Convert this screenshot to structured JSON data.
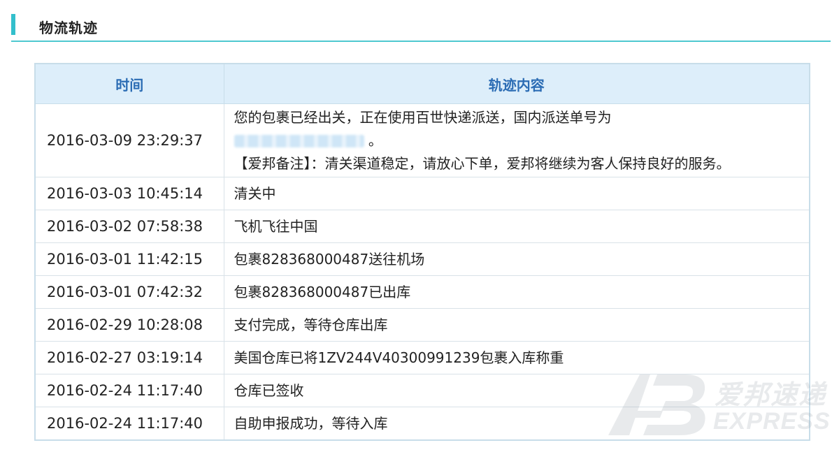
{
  "section": {
    "title": "物流轨迹"
  },
  "table": {
    "headers": {
      "time": "时间",
      "content": "轨迹内容"
    },
    "first_row": {
      "time": "2016-03-09 23:29:37",
      "line1": "您的包裹已经出关，正在使用百世快递派送，国内派送单号为",
      "line2_suffix": "。",
      "line3": "【爱邦备注】：清关渠道稳定，请放心下单，爱邦将继续为客人保持良好的服务。"
    },
    "rows": [
      {
        "time": "2016-03-03 10:45:14",
        "content": "清关中"
      },
      {
        "time": "2016-03-02 07:58:38",
        "content": "飞机飞往中国"
      },
      {
        "time": "2016-03-01 11:42:15",
        "content": "包裹828368000487送往机场"
      },
      {
        "time": "2016-03-01 07:42:32",
        "content": "包裹828368000487已出库"
      },
      {
        "time": "2016-02-29 10:28:08",
        "content": "支付完成，等待仓库出库"
      },
      {
        "time": "2016-02-27 03:19:14",
        "content": "美国仓库已将1ZV244V40300991239包裹入库称重"
      },
      {
        "time": "2016-02-24 11:17:40",
        "content": "仓库已签收"
      },
      {
        "time": "2016-02-24 11:17:40",
        "content": "自助申报成功，等待入库"
      }
    ]
  },
  "watermark": {
    "brand_cn": "爱邦速递",
    "brand_en": "EXPRESS"
  },
  "colors": {
    "accent": "#33bfcc",
    "header_bg": "#ddeefa",
    "header_text": "#2b6cb4",
    "border": "#c8dde9"
  }
}
